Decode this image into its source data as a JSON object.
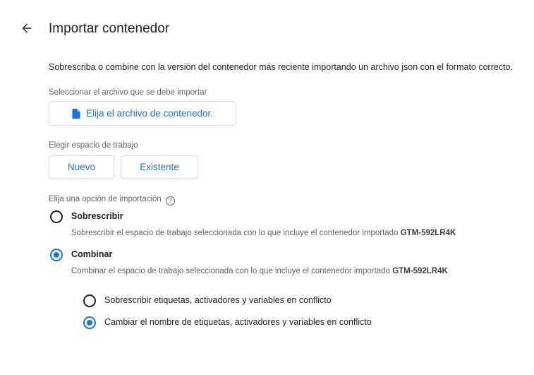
{
  "header": {
    "title": "Importar contenedor",
    "back_icon": "arrow-back-icon"
  },
  "intro": "Sobrescriba o combine con la versión del contenedor más reciente importando un archivo json con el formato correcto.",
  "file": {
    "label": "Seleccionar el archivo que se debe importar",
    "button": "Elija el archivo de contenedor.",
    "icon": "file-icon"
  },
  "workspace": {
    "label": "Elegir espacio de trabajo",
    "new": "Nuevo",
    "existing": "Existente"
  },
  "import_option": {
    "label": "Elija una opción de importación",
    "help_icon": "help-icon",
    "overwrite": {
      "title": "Sobrescribir",
      "desc": "Sobrescribir el espacio de trabajo seleccionada con lo que incluye el contenedor importado",
      "container_id": "GTM-592LR4K",
      "selected": false
    },
    "merge": {
      "title": "Combinar",
      "desc": "Combinar el espacio de trabajo seleccionada con lo que incluye el contenedor importado",
      "container_id": "GTM-592LR4K",
      "selected": true
    },
    "merge_sub": {
      "overwrite_conflicts": "Sobrescribir etiquetas, activadores y variables en conflicto",
      "rename_conflicts": "Cambiar el nombre de etiquetas, activadores y variables en conflicto",
      "selected": "rename_conflicts"
    }
  },
  "colors": {
    "accent": "#1a73e8",
    "text": "#202124",
    "muted": "#5f6368"
  }
}
